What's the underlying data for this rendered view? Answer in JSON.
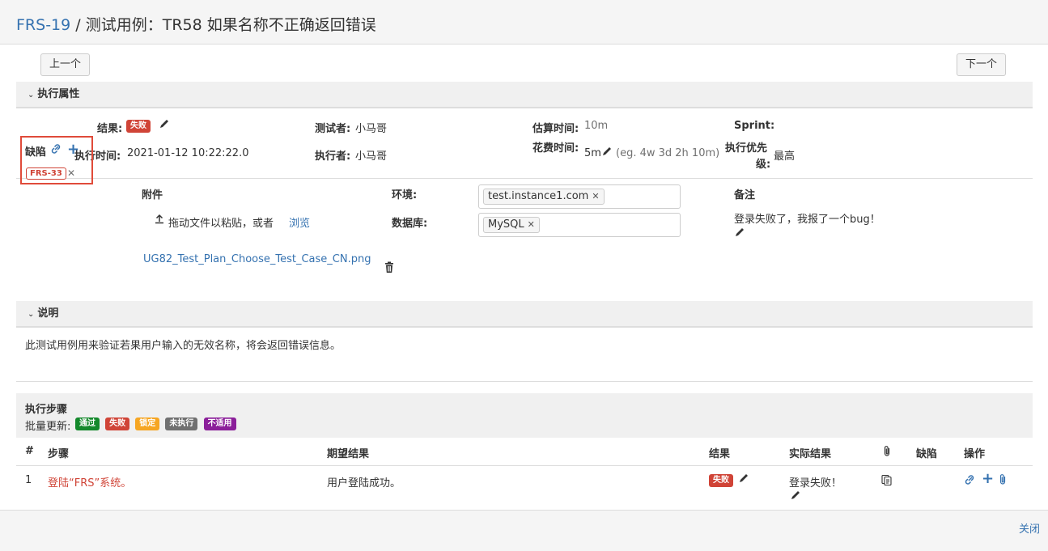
{
  "header": {
    "issue_key": "FRS-19",
    "separator": " / ",
    "title": "测试用例：TR58 如果名称不正确返回错误"
  },
  "nav": {
    "prev_label": "上一个",
    "next_label": "下一个"
  },
  "exec_props": {
    "section_title": "执行属性",
    "result_label": "结果:",
    "result_value": "失败",
    "tester_label": "测试者:",
    "tester_value": "小马哥",
    "estimate_label": "估算时间:",
    "estimate_value": "10m",
    "sprint_label": "Sprint:",
    "exec_time_label": "执行时间:",
    "exec_time_value": "2021-01-12 10:22:22.0",
    "executor_label": "执行者:",
    "executor_value": "小马哥",
    "spent_label": "花费时间:",
    "spent_value": "5m",
    "spent_hint": "(eg. 4w 3d 2h 10m)",
    "priority_label_1": "执行优先",
    "priority_label_2": "级:",
    "priority_value": "最高"
  },
  "defects": {
    "label": "缺陷",
    "items": [
      "FRS-33"
    ]
  },
  "attachments": {
    "label": "附件",
    "drop_text": "拖动文件以粘贴，或者",
    "browse_label": "浏览",
    "file_name": "UG82_Test_Plan_Choose_Test_Case_CN.png"
  },
  "environment": {
    "label": "环境:",
    "value": "test.instance1.com"
  },
  "database": {
    "label": "数据库:",
    "value": "MySQL"
  },
  "notes": {
    "label": "备注",
    "text": "登录失败了，我报了一个bug！"
  },
  "description": {
    "section_title": "说明",
    "text": "此测试用例用来验证若果用户输入的无效名称，将会返回错误信息。"
  },
  "steps": {
    "section_title": "执行步骤",
    "bulk_label": "批量更新:",
    "bulk_options": [
      "通过",
      "失败",
      "锁定",
      "未执行",
      "不适用"
    ],
    "columns": [
      "#",
      "步骤",
      "期望结果",
      "结果",
      "实际结果",
      "缺陷",
      "操作"
    ],
    "rows": [
      {
        "num": "1",
        "step": "登陆“FRS”系统。",
        "expected": "用户登陆成功。",
        "result": "失败",
        "actual": "登录失败！"
      }
    ]
  },
  "footer": {
    "close_label": "关闭"
  },
  "colors": {
    "link": "#3572b0",
    "fail": "#d04437",
    "pass": "#14892c",
    "locked": "#f6a623",
    "unexecuted": "#707070",
    "na": "#8b1f9a",
    "highlight": "#e04b3a"
  }
}
